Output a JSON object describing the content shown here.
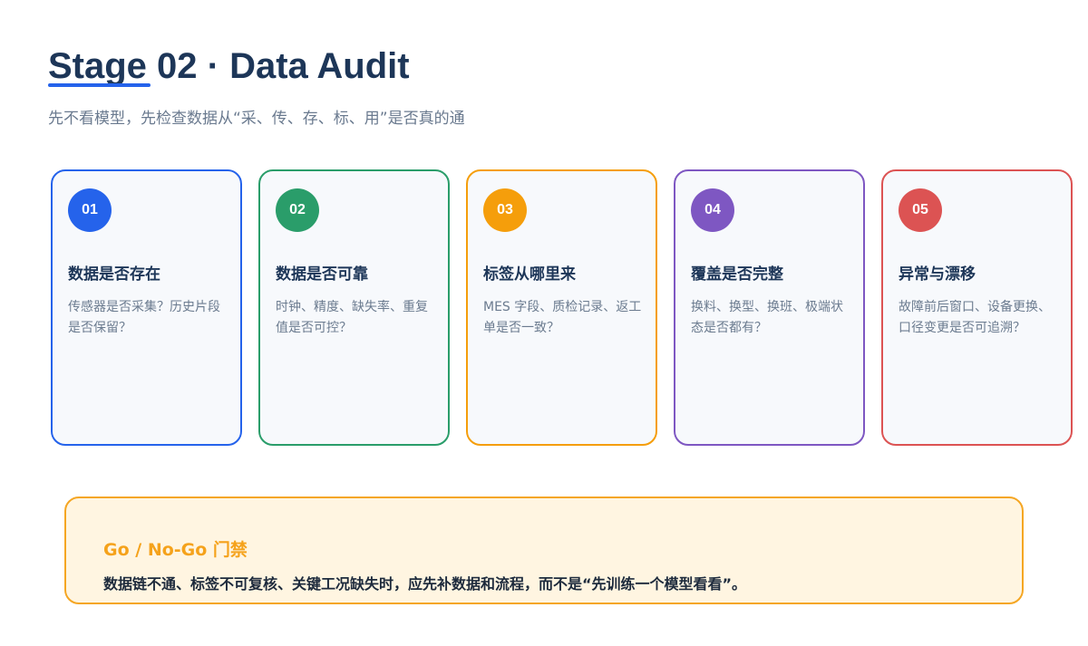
{
  "header": {
    "title": "Stage 02 · Data Audit",
    "subtitle": "先不看模型，先检查数据从“采、传、存、标、用”是否真的通",
    "accent_color": "#2563eb"
  },
  "cards": [
    {
      "number": "01",
      "title": "数据是否存在",
      "description": "传感器是否采集？历史片段是否保留？",
      "color": "#2563eb"
    },
    {
      "number": "02",
      "title": "数据是否可靠",
      "description": "时钟、精度、缺失率、重复值是否可控？",
      "color": "#2a9d6a"
    },
    {
      "number": "03",
      "title": "标签从哪里来",
      "description": "MES 字段、质检记录、返工单是否一致？",
      "color": "#f59e0b"
    },
    {
      "number": "04",
      "title": "覆盖是否完整",
      "description": "换料、换型、换班、极端状态是否都有？",
      "color": "#7e57c2"
    },
    {
      "number": "05",
      "title": "异常与漂移",
      "description": "故障前后窗口、设备更换、口径变更是否可追溯？",
      "color": "#dc5353"
    }
  ],
  "gate": {
    "title": "Go / No-Go 门禁",
    "body": "数据链不通、标签不可复核、关键工况缺失时，应先补数据和流程，而不是“先训练一个模型看看”。",
    "color": "#f5a623"
  }
}
